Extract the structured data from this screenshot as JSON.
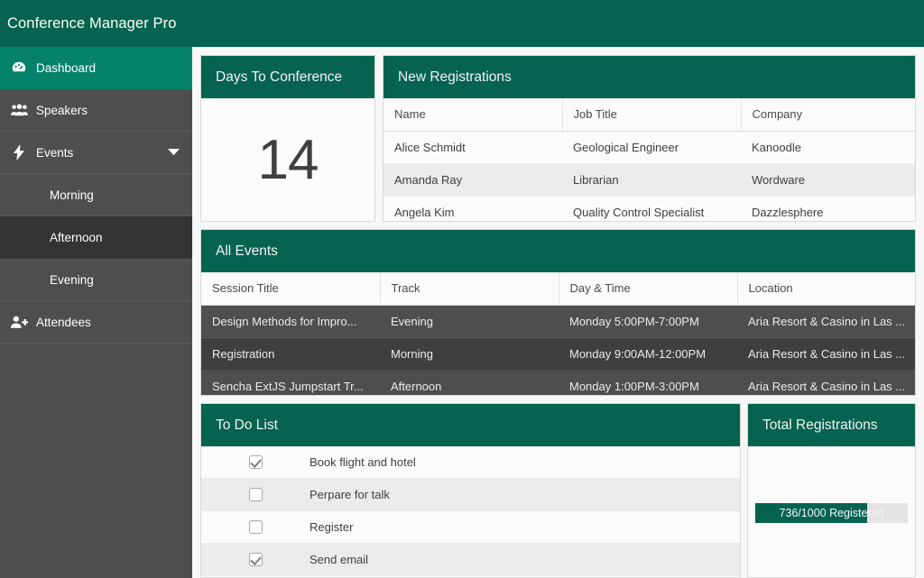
{
  "app": {
    "title": "Conference Manager Pro"
  },
  "sidebar": {
    "items": [
      {
        "label": "Dashboard",
        "icon": "dashboard-icon",
        "state": "active",
        "level": "top"
      },
      {
        "label": "Speakers",
        "icon": "speakers-icon",
        "state": "normal",
        "level": "top"
      },
      {
        "label": "Events",
        "icon": "events-bolt-icon",
        "state": "expanded",
        "level": "top",
        "chevron": "chevron-down-icon"
      },
      {
        "label": "Morning",
        "icon": "",
        "state": "normal",
        "level": "sub"
      },
      {
        "label": "Afternoon",
        "icon": "",
        "state": "selected",
        "level": "sub"
      },
      {
        "label": "Evening",
        "icon": "",
        "state": "normal",
        "level": "sub"
      },
      {
        "label": "Attendees",
        "icon": "attendees-add-icon",
        "state": "normal",
        "level": "top"
      }
    ]
  },
  "days_panel": {
    "title": "Days To Conference",
    "value": "14"
  },
  "registrations_panel": {
    "title": "New Registrations",
    "columns": [
      "Name",
      "Job Title",
      "Company"
    ],
    "rows": [
      [
        "Alice Schmidt",
        "Geological Engineer",
        "Kanoodle"
      ],
      [
        "Amanda Ray",
        "Librarian",
        "Wordware"
      ],
      [
        "Angela Kim",
        "Quality Control Specialist",
        "Dazzlesphere"
      ]
    ]
  },
  "events_panel": {
    "title": "All Events",
    "columns": [
      "Session Title",
      "Track",
      "Day & Time",
      "Location"
    ],
    "rows": [
      [
        "Design Methods for Impro...",
        "Evening",
        "Monday 5:00PM-7:00PM",
        "Aria Resort & Casino in Las ..."
      ],
      [
        "Registration",
        "Morning",
        "Monday 9:00AM-12:00PM",
        "Aria Resort & Casino in Las ..."
      ],
      [
        "Sencha ExtJS Jumpstart Tr...",
        "Afternoon",
        "Monday 1:00PM-3:00PM",
        "Aria Resort & Casino in Las ..."
      ]
    ]
  },
  "todo_panel": {
    "title": "To Do List",
    "items": [
      {
        "text": "Book flight and hotel",
        "checked": true
      },
      {
        "text": "Perpare for talk",
        "checked": false
      },
      {
        "text": "Register",
        "checked": false
      },
      {
        "text": "Send email",
        "checked": true
      }
    ]
  },
  "total_panel": {
    "title": "Total Registrations",
    "label": "736/1000 Registered",
    "value": 736,
    "max": 1000,
    "percent": 73.6
  },
  "colors": {
    "brand_green": "#05634f",
    "accent_green": "#05836a",
    "sidebar_gray": "#4e4e4e",
    "sidebar_selected": "#333333",
    "grid_dark": "#4e4e4e",
    "grid_dark_alt": "#3f3f3f"
  }
}
